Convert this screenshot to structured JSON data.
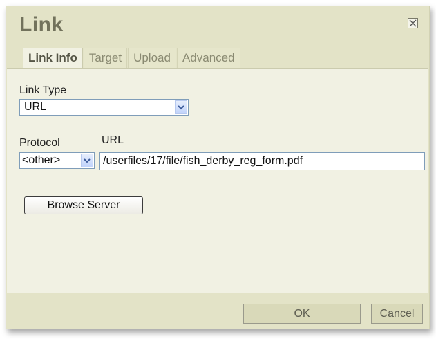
{
  "dialog": {
    "title": "Link",
    "close_icon": "close-icon"
  },
  "tabs": [
    {
      "label": "Link Info",
      "active": true
    },
    {
      "label": "Target",
      "active": false
    },
    {
      "label": "Upload",
      "active": false
    },
    {
      "label": "Advanced",
      "active": false
    }
  ],
  "link_info": {
    "link_type_label": "Link Type",
    "link_type_value": "URL",
    "protocol_label": "Protocol",
    "protocol_value": "<other>",
    "url_label": "URL",
    "url_value": "/userfiles/17/file/fish_derby_reg_form.pdf",
    "browse_label": "Browse Server"
  },
  "footer": {
    "ok_label": "OK",
    "cancel_label": "Cancel"
  },
  "colors": {
    "dialog_bg": "#e3e3c7",
    "panel_bg": "#f1f1e3",
    "title_text": "#72725c"
  }
}
